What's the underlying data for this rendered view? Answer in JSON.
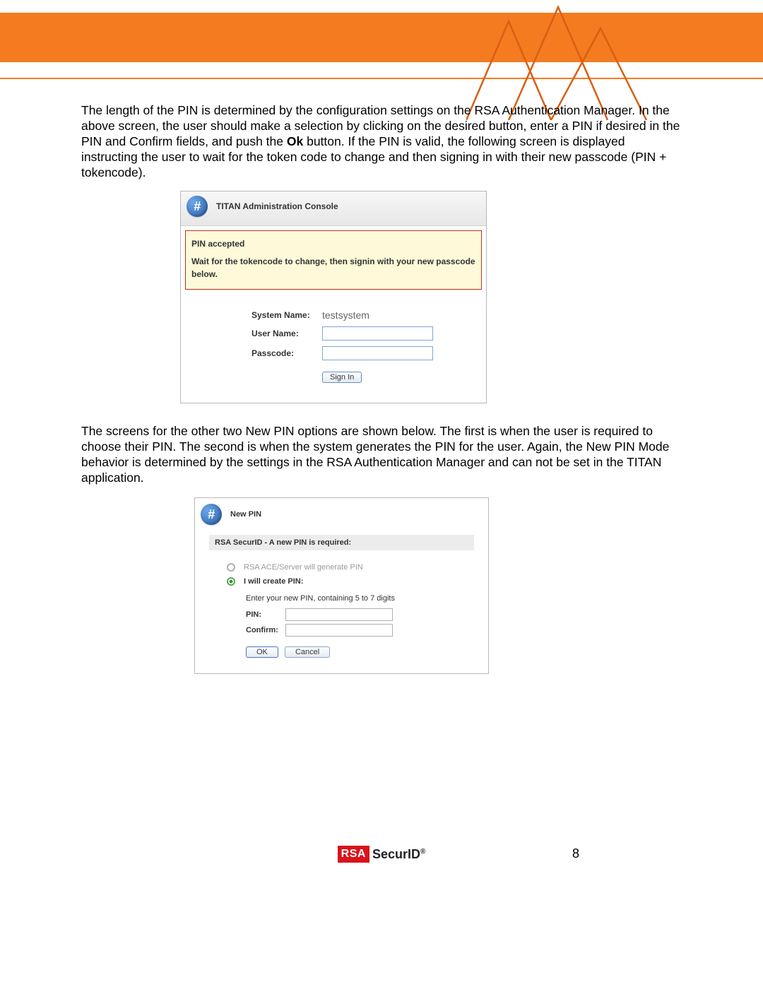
{
  "para1_pre": "The length of the PIN is determined by the configuration settings on the RSA Authentication Manager. In the above screen, the user should make a selection by clicking on the desired button, enter a PIN if desired in the PIN and Confirm fields, and push the ",
  "para1_bold": "Ok",
  "para1_post": " button. If the PIN is valid, the following screen is displayed instructing the user to wait for the token code to change and then signing in with their new passcode (PIN + tokencode).",
  "para2": "The screens for the other two New PIN options are shown below. The first is when the user is required to choose their PIN. The second is when the system generates the PIN for the user. Again, the New PIN Mode behavior is determined by the settings in the RSA Authentication Manager and can not be set in the TITAN application.",
  "titan": {
    "title": "TITAN Administration Console",
    "notice_header": "PIN accepted",
    "notice_body": "Wait for the tokencode to change, then signin with your new passcode below.",
    "label_system": "System Name:",
    "value_system": "testsystem",
    "label_user": "User Name:",
    "label_passcode": "Passcode:",
    "signin": "Sign In"
  },
  "newpin": {
    "title": "New PIN",
    "band": "RSA SecurID - A new PIN is required:",
    "opt_server": "RSA ACE/Server will generate PIN",
    "opt_user": "I will create PIN:",
    "instruction": "Enter your new PIN, containing 5 to 7 digits",
    "label_pin": "PIN:",
    "label_confirm": "Confirm:",
    "ok": "OK",
    "cancel": "Cancel"
  },
  "footer": {
    "rsa": "RSA",
    "securid": "SecurID",
    "reg": "®",
    "page_number": "8"
  }
}
